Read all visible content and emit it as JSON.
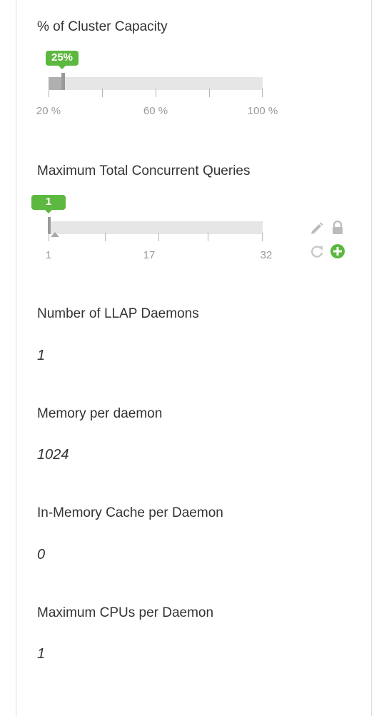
{
  "cluster_capacity": {
    "label": "% of Cluster Capacity",
    "value_badge": "25%",
    "value_percent": 25,
    "min": 20,
    "max": 100,
    "tick_labels": [
      "20 %",
      "60 %",
      "100 %"
    ]
  },
  "concurrent_queries": {
    "label": "Maximum Total Concurrent Queries",
    "value_badge": "1",
    "value": 1,
    "min": 1,
    "max": 32,
    "tick_labels": [
      "1",
      "17",
      "32"
    ],
    "actions": [
      "pencil-icon",
      "lock-icon",
      "undo-icon",
      "add-icon"
    ]
  },
  "properties": [
    {
      "label": "Number of LLAP Daemons",
      "value": "1"
    },
    {
      "label": "Memory per daemon",
      "value": "1024"
    },
    {
      "label": "In-Memory Cache per Daemon",
      "value": "0"
    },
    {
      "label": "Maximum CPUs per Daemon",
      "value": "1"
    }
  ],
  "colors": {
    "accent_green": "#5cb83f",
    "track": "#e6e6e6",
    "fill": "#b0b0b0",
    "muted_icon": "#bbbbbb"
  }
}
